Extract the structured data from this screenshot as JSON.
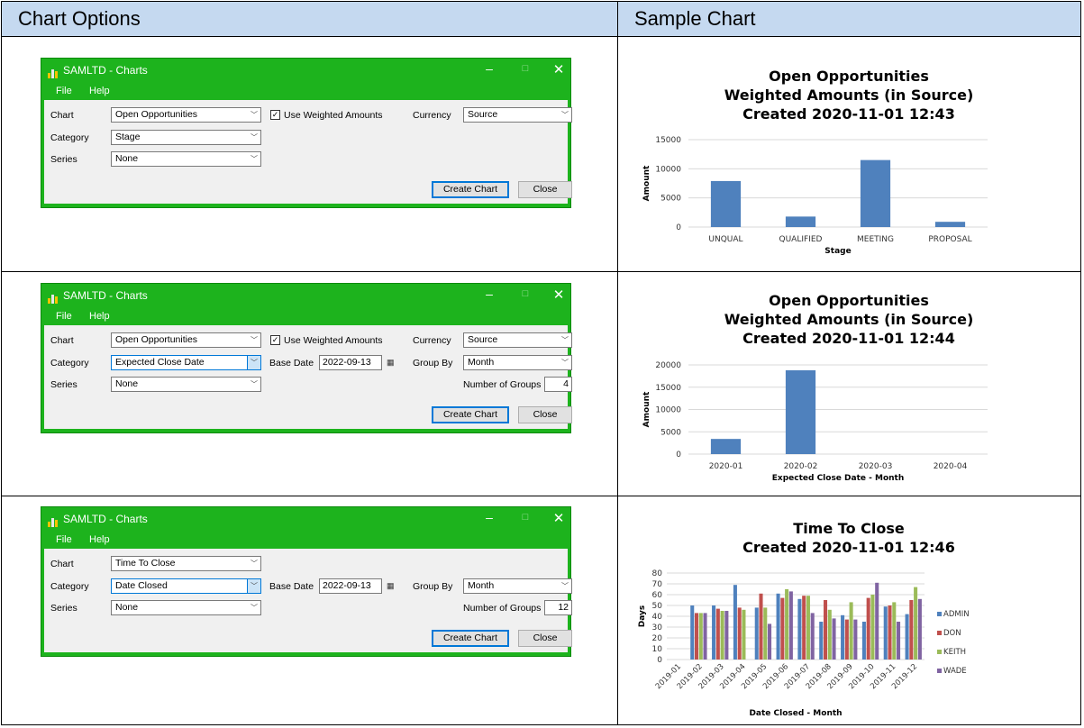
{
  "headers": {
    "left": "Chart Options",
    "right": "Sample Chart"
  },
  "windows": [
    {
      "title": "SAMLTD - Charts",
      "menu": {
        "file": "File",
        "help": "Help"
      },
      "chart_label": "Chart",
      "chart_value": "Open Opportunities",
      "weighted_label": "Use Weighted Amounts",
      "weighted_checked": true,
      "currency_label": "Currency",
      "currency_value": "Source",
      "category_label": "Category",
      "category_value": "Stage",
      "series_label": "Series",
      "series_value": "None",
      "create_label": "Create Chart",
      "close_label": "Close"
    },
    {
      "title": "SAMLTD - Charts",
      "menu": {
        "file": "File",
        "help": "Help"
      },
      "chart_label": "Chart",
      "chart_value": "Open Opportunities",
      "weighted_label": "Use Weighted Amounts",
      "weighted_checked": true,
      "currency_label": "Currency",
      "currency_value": "Source",
      "category_label": "Category",
      "category_value": "Expected Close Date",
      "base_date_label": "Base Date",
      "base_date_value": "2022-09-13",
      "group_by_label": "Group By",
      "group_by_value": "Month",
      "series_label": "Series",
      "series_value": "None",
      "num_groups_label": "Number of Groups",
      "num_groups_value": "4",
      "create_label": "Create Chart",
      "close_label": "Close"
    },
    {
      "title": "SAMLTD - Charts",
      "menu": {
        "file": "File",
        "help": "Help"
      },
      "chart_label": "Chart",
      "chart_value": "Time To Close",
      "category_label": "Category",
      "category_value": "Date Closed",
      "base_date_label": "Base Date",
      "base_date_value": "2022-09-13",
      "group_by_label": "Group By",
      "group_by_value": "Month",
      "series_label": "Series",
      "series_value": "None",
      "num_groups_label": "Number of Groups",
      "num_groups_value": "12",
      "create_label": "Create Chart",
      "close_label": "Close"
    }
  ],
  "chart_data": [
    {
      "type": "bar",
      "title": [
        "Open Opportunities",
        "Weighted Amounts (in Source)",
        "Created 2020-11-01 12:43"
      ],
      "categories": [
        "UNQUAL",
        "QUALIFIED",
        "MEETING",
        "PROPOSAL"
      ],
      "values": [
        7900,
        1800,
        11500,
        900
      ],
      "xlabel": "Stage",
      "ylabel": "Amount",
      "ylim": [
        0,
        15000
      ],
      "yticks": [
        0,
        5000,
        10000,
        15000
      ],
      "color": "#4f81bd",
      "grid": true
    },
    {
      "type": "bar",
      "title": [
        "Open Opportunities",
        "Weighted Amounts (in Source)",
        "Created 2020-11-01 12:44"
      ],
      "categories": [
        "2020-01",
        "2020-02",
        "2020-03",
        "2020-04"
      ],
      "values": [
        3400,
        18800,
        0,
        0
      ],
      "xlabel": "Expected Close Date - Month",
      "ylabel": "Amount",
      "ylim": [
        0,
        20000
      ],
      "yticks": [
        0,
        5000,
        10000,
        15000,
        20000
      ],
      "color": "#4f81bd",
      "grid": true
    },
    {
      "type": "bar",
      "title": [
        "Time To Close",
        "Created 2020-11-01 12:46"
      ],
      "categories": [
        "2019-01",
        "2019-02",
        "2019-03",
        "2019-04",
        "2019-05",
        "2019-06",
        "2019-07",
        "2019-08",
        "2019-09",
        "2019-10",
        "2019-11",
        "2019-12"
      ],
      "series": [
        {
          "name": "ADMIN",
          "color": "#4f81bd",
          "values": [
            0,
            50,
            50,
            69,
            48,
            61,
            56,
            35,
            41,
            35,
            49,
            42
          ]
        },
        {
          "name": "DON",
          "color": "#c0504d",
          "values": [
            0,
            43,
            47,
            48,
            61,
            57,
            59,
            55,
            37,
            57,
            50,
            55
          ]
        },
        {
          "name": "KEITH",
          "color": "#9bbb59",
          "values": [
            0,
            43,
            45,
            46,
            48,
            65,
            59,
            46,
            53,
            60,
            53,
            67
          ]
        },
        {
          "name": "WADE",
          "color": "#8064a2",
          "values": [
            0,
            43,
            45,
            0,
            33,
            63,
            43,
            38,
            37,
            71,
            35,
            56
          ]
        }
      ],
      "xlabel": "Date Closed - Month",
      "ylabel": "Days",
      "ylim": [
        0,
        80
      ],
      "yticks": [
        0,
        10,
        20,
        30,
        40,
        50,
        60,
        70,
        80
      ],
      "grid": true,
      "legend": "right"
    }
  ]
}
